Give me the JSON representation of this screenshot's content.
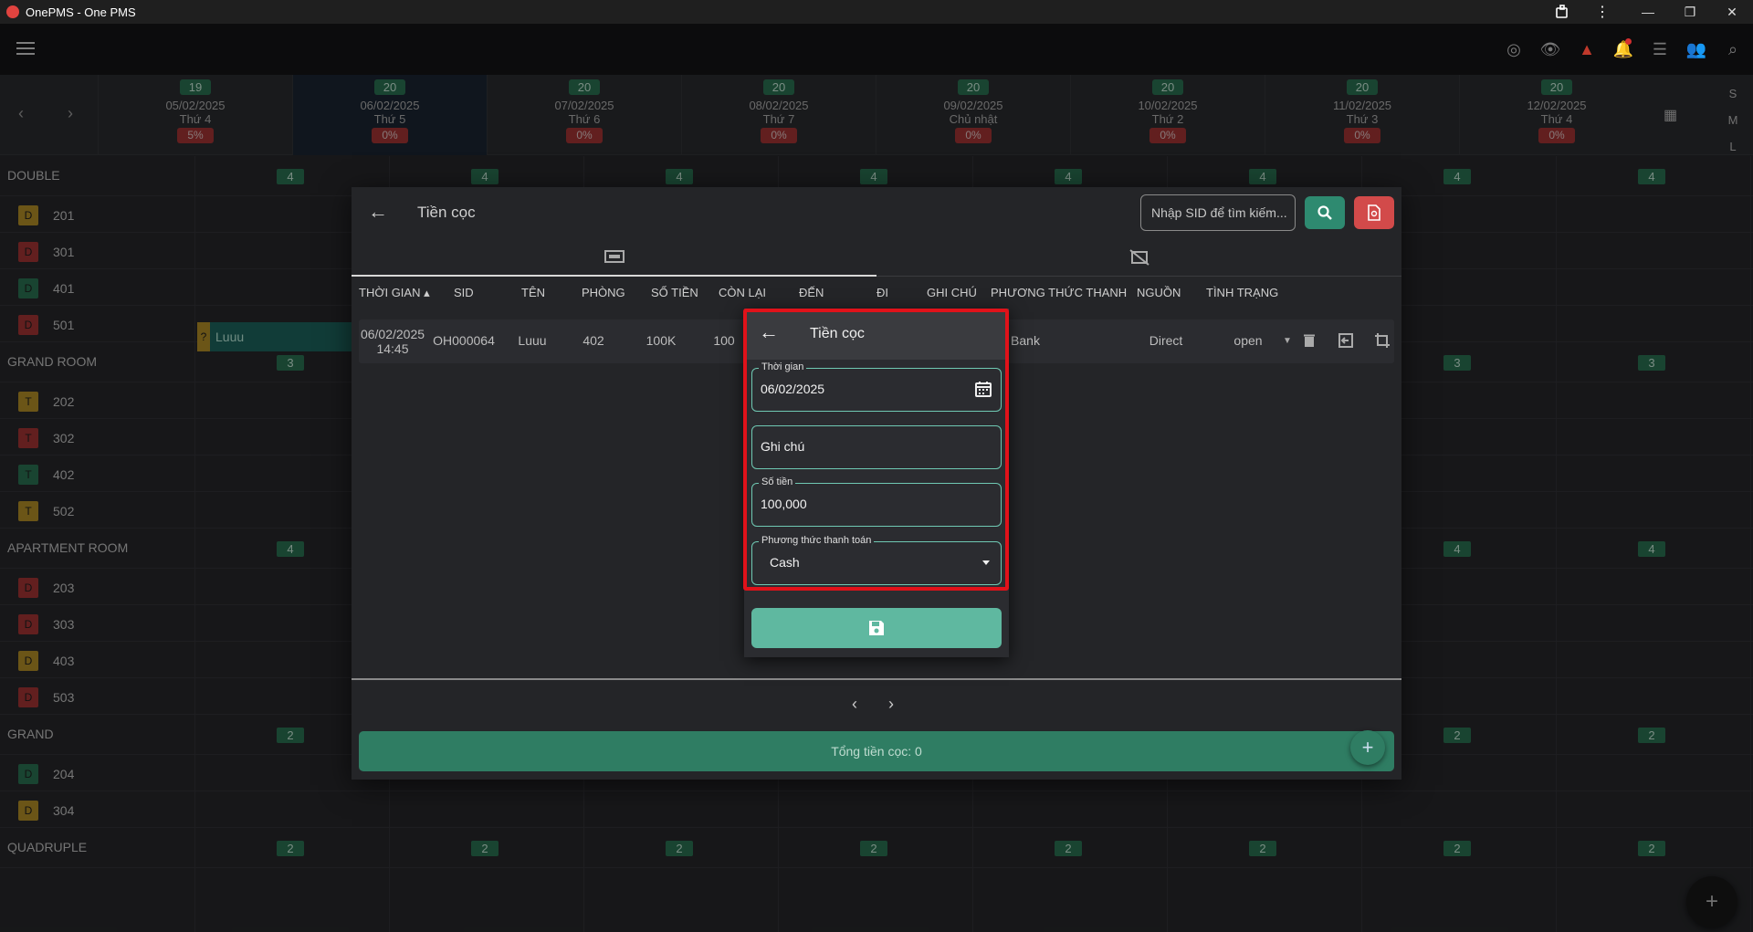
{
  "window": {
    "title": "OnePMS - One PMS"
  },
  "dates": [
    {
      "avail": "19",
      "date": "05/02/2025",
      "dow": "Thứ 4",
      "pct": "5%"
    },
    {
      "avail": "20",
      "date": "06/02/2025",
      "dow": "Thứ 5",
      "pct": "0%"
    },
    {
      "avail": "20",
      "date": "07/02/2025",
      "dow": "Thứ 6",
      "pct": "0%"
    },
    {
      "avail": "20",
      "date": "08/02/2025",
      "dow": "Thứ 7",
      "pct": "0%"
    },
    {
      "avail": "20",
      "date": "09/02/2025",
      "dow": "Chủ nhật",
      "pct": "0%"
    },
    {
      "avail": "20",
      "date": "10/02/2025",
      "dow": "Thứ 2",
      "pct": "0%"
    },
    {
      "avail": "20",
      "date": "11/02/2025",
      "dow": "Thứ 3",
      "pct": "0%"
    },
    {
      "avail": "20",
      "date": "12/02/2025",
      "dow": "Thứ 4",
      "pct": "0%"
    }
  ],
  "size_options": [
    "S",
    "M",
    "L"
  ],
  "groups": [
    {
      "name": "DOUBLE",
      "count": "4",
      "rooms": [
        {
          "badge": "D",
          "color": "#c39b2a",
          "num": "201"
        },
        {
          "badge": "D",
          "color": "#b23a3a",
          "num": "301"
        },
        {
          "badge": "D",
          "color": "#2e7d5a",
          "num": "401"
        },
        {
          "badge": "D",
          "color": "#b23a3a",
          "num": "501"
        }
      ]
    },
    {
      "name": "GRAND ROOM",
      "count": "3",
      "rooms": [
        {
          "badge": "T",
          "color": "#c39b2a",
          "num": "202"
        },
        {
          "badge": "T",
          "color": "#b23a3a",
          "num": "302"
        },
        {
          "badge": "T",
          "color": "#2e7d5a",
          "num": "402"
        },
        {
          "badge": "T",
          "color": "#c39b2a",
          "num": "502"
        }
      ]
    },
    {
      "name": "APARTMENT ROOM",
      "count": "4",
      "rooms": [
        {
          "badge": "D",
          "color": "#b23a3a",
          "num": "203"
        },
        {
          "badge": "D",
          "color": "#b23a3a",
          "num": "303"
        },
        {
          "badge": "D",
          "color": "#c39b2a",
          "num": "403"
        },
        {
          "badge": "D",
          "color": "#b23a3a",
          "num": "503"
        }
      ]
    },
    {
      "name": "GRAND",
      "count": "2",
      "rooms": [
        {
          "badge": "D",
          "color": "#2e7d5a",
          "num": "204"
        },
        {
          "badge": "D",
          "color": "#c39b2a",
          "num": "304"
        }
      ]
    },
    {
      "name": "QUADRUPLE",
      "count": "2",
      "rooms": []
    }
  ],
  "booking": {
    "flag": "?",
    "name": "Luuu"
  },
  "deposit_dialog": {
    "title": "Tiền cọc",
    "search_placeholder": "Nhập SID để tìm kiếm...",
    "columns": [
      "THỜI GIAN ▴",
      "SID",
      "TÊN",
      "PHÒNG",
      "SỐ TIỀN",
      "CÒN LẠI",
      "ĐẾN",
      "ĐI",
      "GHI CHÚ",
      "PHƯƠNG THỨC THANH",
      "NGUỒN",
      "TÌNH TRẠNG"
    ],
    "row": {
      "time_date": "06/02/2025",
      "time_clock": "14:45",
      "sid": "OH000064",
      "name": "Luuu",
      "room": "402",
      "amount": "100K",
      "remaining": "100",
      "method": "Bank",
      "source": "Direct",
      "status": "open"
    },
    "total": "Tổng tiền cọc: 0"
  },
  "deposit_form": {
    "title": "Tiền cọc",
    "time_label": "Thời gian",
    "time_value": "06/02/2025",
    "note_label": "Ghi chú",
    "amount_label": "Số tiền",
    "amount_value": "100,000",
    "method_label": "Phương thức thanh toán",
    "method_value": "Cash"
  }
}
